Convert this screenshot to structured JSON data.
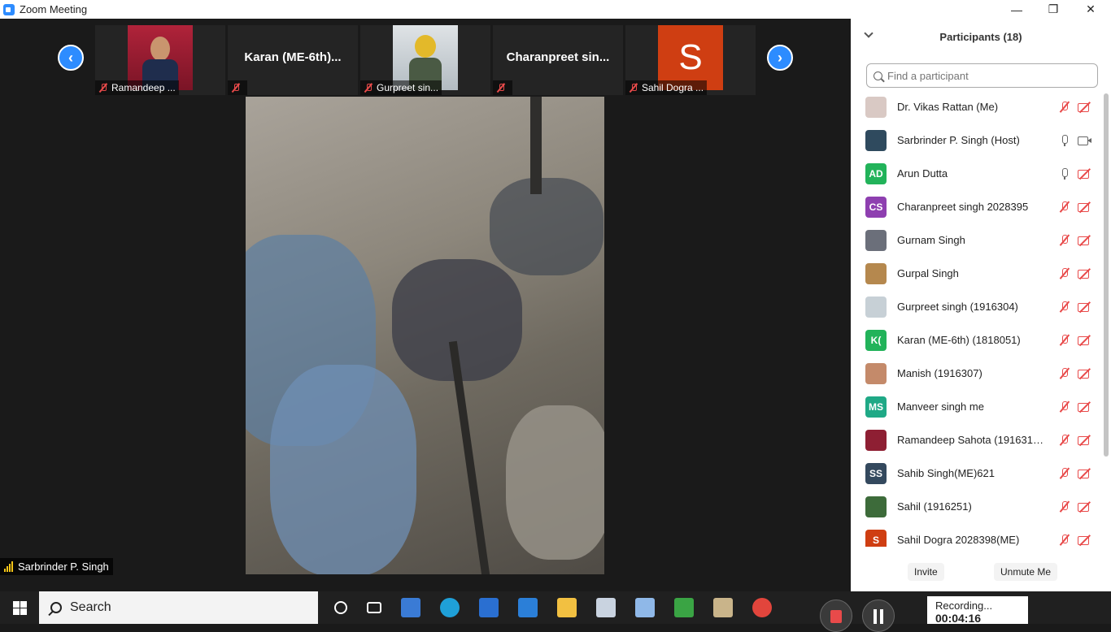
{
  "window": {
    "title": "Zoom Meeting",
    "minimize": "—",
    "restore": "❐",
    "close": "✕"
  },
  "gallery": {
    "prev_icon": "chevron-left-icon",
    "next_icon": "chevron-right-icon",
    "prev_glyph": "‹",
    "next_glyph": "›",
    "tiles": [
      {
        "name": "Ramandeep ...",
        "big": "",
        "has_photo": true,
        "photo_color": "#b0233a"
      },
      {
        "name": "",
        "big": "Karan (ME-6th)...",
        "has_photo": false
      },
      {
        "name": "Gurpreet sin...",
        "big": "",
        "has_photo": true,
        "photo_color": "#c9cfd4"
      },
      {
        "name": "",
        "big": "Charanpreet sin...",
        "has_photo": false
      },
      {
        "name": "Sahil Dogra ...",
        "big": "S",
        "has_photo": true,
        "photo_color": "#cf3e12"
      }
    ]
  },
  "main_video": {
    "speaker": "Sarbrinder P. Singh"
  },
  "participants": {
    "title": "Participants (18)",
    "search_placeholder": "Find a participant",
    "list": [
      {
        "name": "Dr. Vikas Rattan (Me)",
        "initials": "",
        "color": "#d9c9c4",
        "mic": "muted",
        "cam": "off"
      },
      {
        "name": "Sarbrinder P. Singh (Host)",
        "initials": "",
        "color": "#2f4a5e",
        "mic": "on",
        "cam": "on"
      },
      {
        "name": "Arun Dutta",
        "initials": "AD",
        "color": "#22b35a",
        "mic": "on",
        "cam": "off"
      },
      {
        "name": "Charanpreet singh 2028395",
        "initials": "CS",
        "color": "#8e3fb0",
        "mic": "muted",
        "cam": "off"
      },
      {
        "name": "Gurnam Singh",
        "initials": "",
        "color": "#6b6f7a",
        "mic": "muted",
        "cam": "off"
      },
      {
        "name": "Gurpal Singh",
        "initials": "",
        "color": "#b5884e",
        "mic": "muted",
        "cam": "off"
      },
      {
        "name": "Gurpreet singh (1916304)",
        "initials": "",
        "color": "#c7d0d6",
        "mic": "muted",
        "cam": "off"
      },
      {
        "name": "Karan (ME-6th) (1818051)",
        "initials": "K(",
        "color": "#22b35a",
        "mic": "muted",
        "cam": "off"
      },
      {
        "name": "Manish (1916307)",
        "initials": "",
        "color": "#c48a6a",
        "mic": "muted",
        "cam": "off"
      },
      {
        "name": "Manveer singh me",
        "initials": "MS",
        "color": "#1fa986",
        "mic": "muted",
        "cam": "off"
      },
      {
        "name": "Ramandeep Sahota (1916312)...",
        "initials": "",
        "color": "#8e1f33",
        "mic": "muted",
        "cam": "off"
      },
      {
        "name": "Sahib Singh(ME)621",
        "initials": "SS",
        "color": "#34495e",
        "mic": "muted",
        "cam": "off"
      },
      {
        "name": "Sahil (1916251)",
        "initials": "",
        "color": "#3d6b3a",
        "mic": "muted",
        "cam": "off"
      },
      {
        "name": "Sahil Dogra 2028398(ME)",
        "initials": "S",
        "color": "#cf3e12",
        "mic": "muted",
        "cam": "off"
      }
    ],
    "invite": "Invite",
    "unmute": "Unmute Me"
  },
  "taskbar": {
    "search_label": "Search",
    "recording_label": "Recording...",
    "recording_time": "00:04:16",
    "apps": [
      {
        "icon": "cortana-icon",
        "color": "#202020"
      },
      {
        "icon": "task-view-icon",
        "color": "#202020"
      },
      {
        "icon": "calculator-icon",
        "color": "#3a7bd5"
      },
      {
        "icon": "edge-icon",
        "color": "#1fa0d8"
      },
      {
        "icon": "store-icon",
        "color": "#2a6fd1"
      },
      {
        "icon": "mail-icon",
        "color": "#2b7fd8"
      },
      {
        "icon": "file-explorer-icon",
        "color": "#f2c041"
      },
      {
        "icon": "paint-icon",
        "color": "#c9d3e0"
      },
      {
        "icon": "paint-3d-icon",
        "color": "#8fb8e8"
      },
      {
        "icon": "camtasia-icon",
        "color": "#3aa444"
      },
      {
        "icon": "books-icon",
        "color": "#c9b48a"
      },
      {
        "icon": "chrome-icon",
        "color": "#e2453c"
      }
    ]
  }
}
